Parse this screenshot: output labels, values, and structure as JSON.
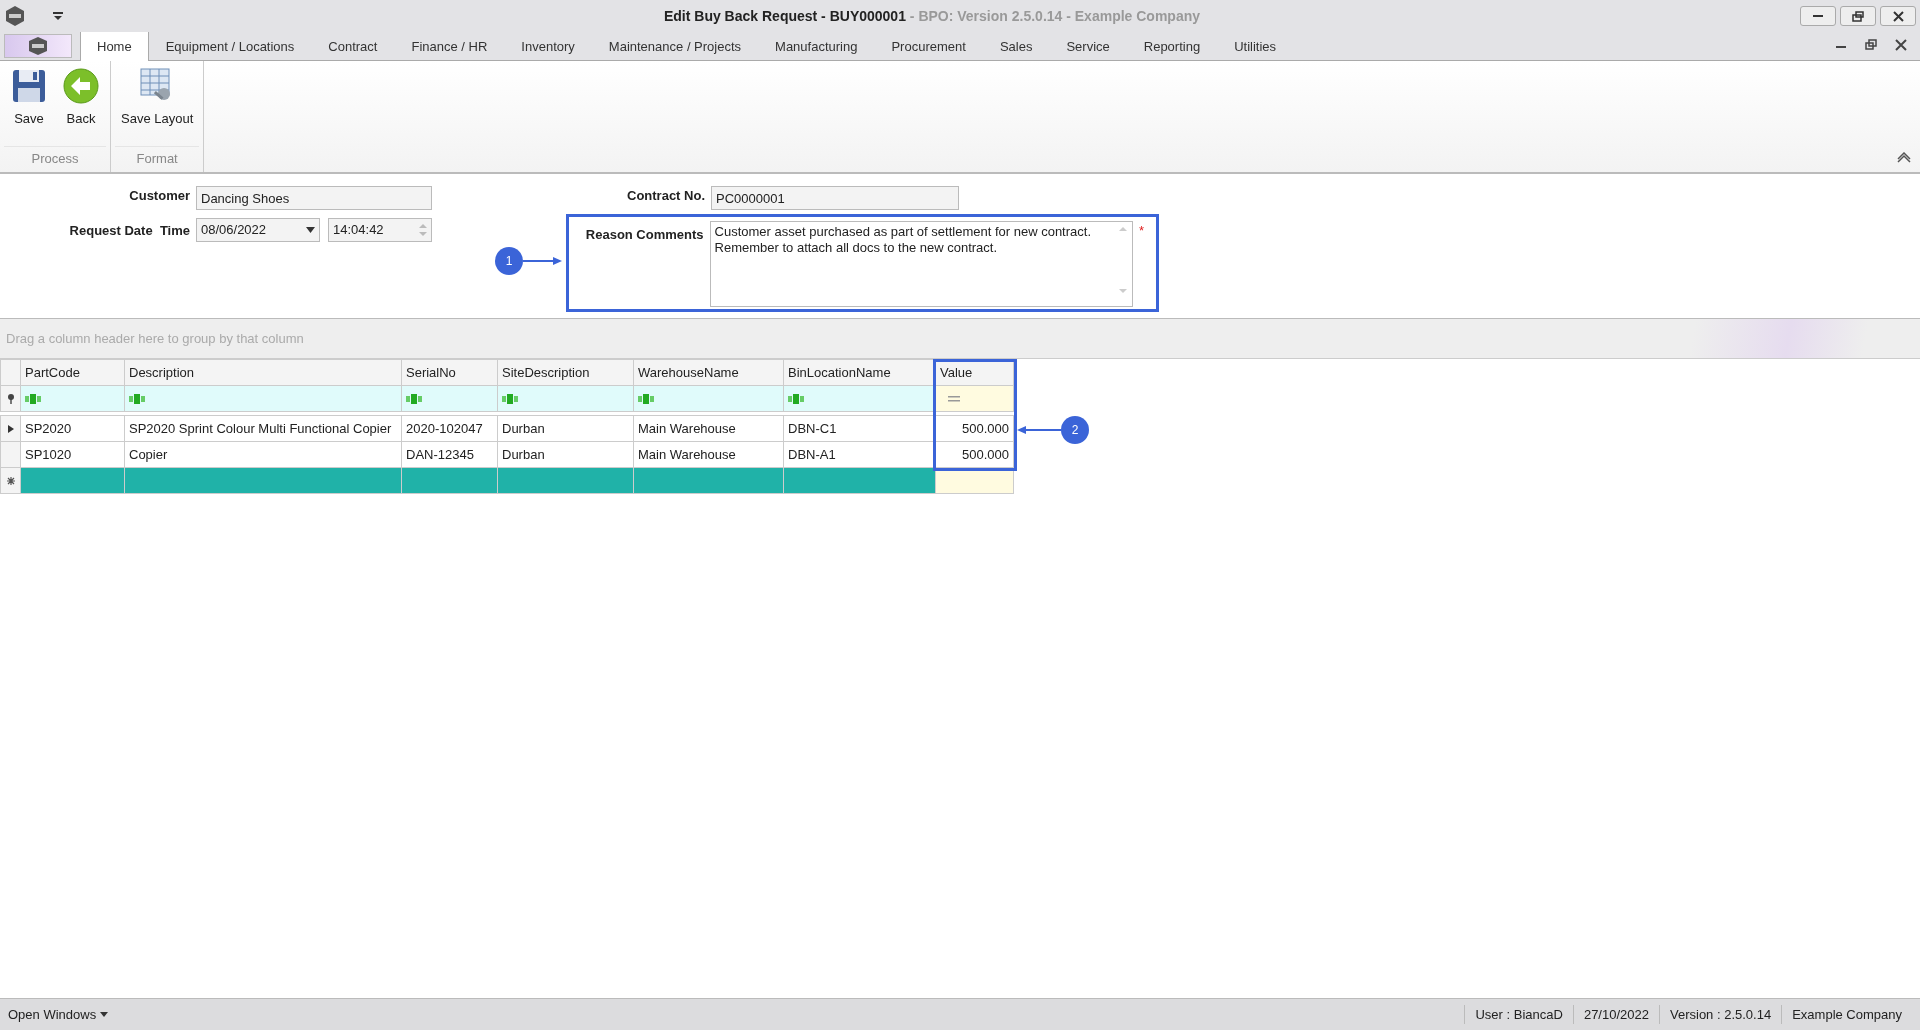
{
  "window": {
    "title": "Edit Buy Back Request - BUY000001",
    "subtitle": " - BPO: Version 2.5.0.14 - Example Company"
  },
  "tabs": [
    {
      "label": "Home",
      "selected": true
    },
    {
      "label": "Equipment / Locations",
      "selected": false
    },
    {
      "label": "Contract",
      "selected": false
    },
    {
      "label": "Finance / HR",
      "selected": false
    },
    {
      "label": "Inventory",
      "selected": false
    },
    {
      "label": "Maintenance / Projects",
      "selected": false
    },
    {
      "label": "Manufacturing",
      "selected": false
    },
    {
      "label": "Procurement",
      "selected": false
    },
    {
      "label": "Sales",
      "selected": false
    },
    {
      "label": "Service",
      "selected": false
    },
    {
      "label": "Reporting",
      "selected": false
    },
    {
      "label": "Utilities",
      "selected": false
    }
  ],
  "ribbon_groups": [
    {
      "label": "Process",
      "buttons": [
        {
          "label": "Save",
          "kind": "save"
        },
        {
          "label": "Back",
          "kind": "back"
        }
      ]
    },
    {
      "label": "Format",
      "buttons": [
        {
          "label": "Save Layout",
          "kind": "layout"
        }
      ]
    }
  ],
  "form": {
    "customer_label": "Customer",
    "customer": "Dancing Shoes",
    "request_label": "Request Date  Time",
    "date": "08/06/2022",
    "time": "14:04:42",
    "contract_label": "Contract No.",
    "contract": "PC0000001",
    "reason_label": "Reason Comments",
    "reason": "Customer asset purchased as part of settlement for new contract.\nRemember to attach all docs to the new contract.",
    "required_mark": "*"
  },
  "grid": {
    "group_hint": "Drag a column header here to group by that column",
    "columns": [
      "PartCode",
      "Description",
      "SerialNo",
      "SiteDescription",
      "WarehouseName",
      "BinLocationName",
      "Value"
    ],
    "rows": [
      {
        "cells": [
          "SP2020",
          "SP2020 Sprint Colour Multi Functional Copier",
          "2020-102047",
          "Durban",
          "Main Warehouse",
          "DBN-C1",
          "500.000"
        ],
        "selected": true
      },
      {
        "cells": [
          "SP1020",
          "Copier",
          "DAN-12345",
          "Durban",
          "Main Warehouse",
          "DBN-A1",
          "500.000"
        ],
        "selected": false
      }
    ]
  },
  "annotations": [
    "1",
    "2"
  ],
  "status_bar": {
    "menu": "Open Windows",
    "items": [
      "User : BiancaD",
      "27/10/2022",
      "Version : 2.5.0.14",
      "Example Company"
    ]
  }
}
